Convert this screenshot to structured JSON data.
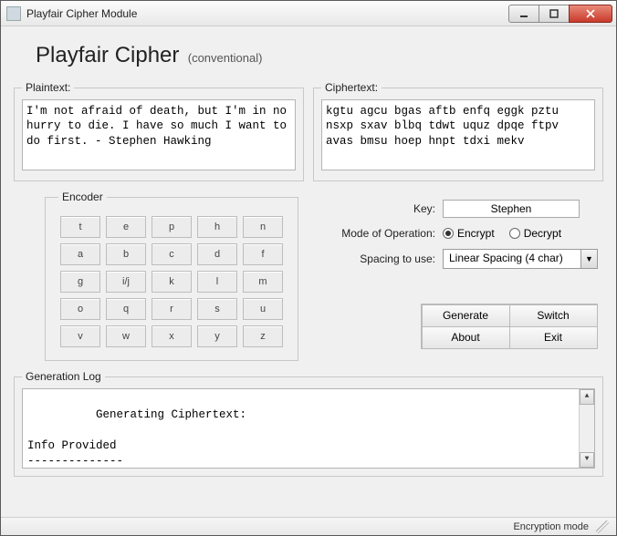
{
  "window": {
    "title": "Playfair Cipher Module"
  },
  "banner": {
    "title": "Playfair Cipher",
    "subtitle": "(conventional)"
  },
  "groups": {
    "plaintext": "Plaintext:",
    "ciphertext": "Ciphertext:",
    "encoder": "Encoder",
    "log": "Generation Log"
  },
  "plaintext_value": "I'm not afraid of death, but I'm in no hurry to die. I have so much I want to do first. - Stephen Hawking",
  "ciphertext_value": "kgtu agcu bgas aftb enfq eggk pztu nsxp sxav blbq tdwt uquz dpqe ftpv avas bmsu hoep hnpt tdxi mekv",
  "encoder_grid": [
    [
      "t",
      "e",
      "p",
      "h",
      "n"
    ],
    [
      "a",
      "b",
      "c",
      "d",
      "f"
    ],
    [
      "g",
      "i/j",
      "k",
      "l",
      "m"
    ],
    [
      "o",
      "q",
      "r",
      "s",
      "u"
    ],
    [
      "v",
      "w",
      "x",
      "y",
      "z"
    ]
  ],
  "controls": {
    "key_label": "Key:",
    "key_value": "Stephen",
    "mode_label": "Mode of Operation:",
    "mode_encrypt": "Encrypt",
    "mode_decrypt": "Decrypt",
    "mode_selected": "encrypt",
    "spacing_label": "Spacing to use:",
    "spacing_value": "Linear Spacing (4 char)"
  },
  "buttons": {
    "generate": "Generate",
    "switch": "Switch",
    "about": "About",
    "exit": "Exit"
  },
  "log_text": "Generating Ciphertext:\n\nInfo Provided\n--------------\n> Plaintext: I'm not afraid of death, but I'm in no hurry to die. I have so mu",
  "statusbar": {
    "mode": "Encryption mode"
  }
}
